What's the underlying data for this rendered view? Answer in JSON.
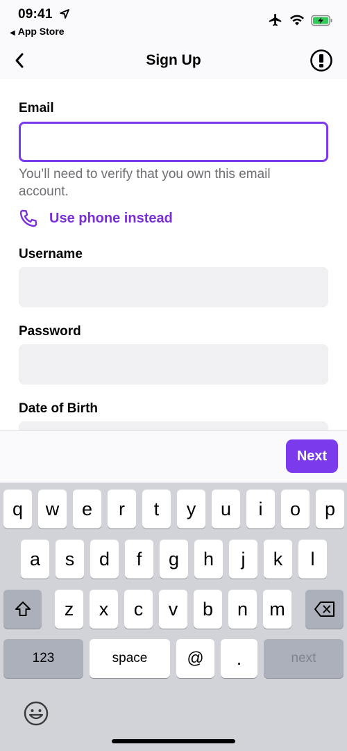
{
  "status_bar": {
    "time": "09:41",
    "back_app": "App Store"
  },
  "nav": {
    "title": "Sign Up",
    "back_icon": "chevron-left-icon",
    "info_icon": "info-circle-icon"
  },
  "form": {
    "email": {
      "label": "Email",
      "value": "",
      "helper": "You’ll need to verify that you own this email account."
    },
    "phone_link": "Use phone instead",
    "username": {
      "label": "Username",
      "value": ""
    },
    "password": {
      "label": "Password",
      "value": ""
    },
    "dob": {
      "label": "Date of Birth",
      "value": ""
    }
  },
  "accessory": {
    "next_label": "Next"
  },
  "keyboard": {
    "row1": [
      "q",
      "w",
      "e",
      "r",
      "t",
      "y",
      "u",
      "i",
      "o",
      "p"
    ],
    "row2": [
      "a",
      "s",
      "d",
      "f",
      "g",
      "h",
      "j",
      "k",
      "l"
    ],
    "row3": [
      "z",
      "x",
      "c",
      "v",
      "b",
      "n",
      "m"
    ],
    "numbers_label": "123",
    "space_label": "space",
    "at_label": "@",
    "dot_label": ".",
    "return_label": "next"
  },
  "colors": {
    "accent": "#7c3aed",
    "link": "#7b2fd8",
    "input_bg": "#f0eff2",
    "keyboard_bg": "#d1d3d9",
    "battery_green": "#34c759"
  }
}
